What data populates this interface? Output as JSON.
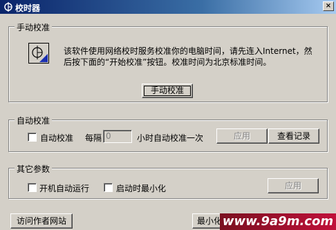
{
  "window": {
    "title": "校时器",
    "close_glyph": "×"
  },
  "manual_group": {
    "legend": "手动校准",
    "description": "该软件使用网络校时服务校准你的电脑时间，请先连入Internet，然后按下面的“开始校准”按钮。校准时间为北京标准时间。",
    "button_label": "手动校准"
  },
  "auto_group": {
    "legend": "自动校准",
    "checkbox_label": "自动校准",
    "every_label": "每隔",
    "interval_value": "0",
    "suffix_label": "小时自动校准一次",
    "apply_label": "应用",
    "view_log_label": "查看记录"
  },
  "other_group": {
    "legend": "其它参数",
    "startup_label": "开机自动运行",
    "minimize_label": "启动时最小化",
    "apply_label": "应用"
  },
  "footer": {
    "visit_label": "访问作者网站",
    "minimize_label": "最小化到系"
  },
  "watermark": {
    "text": "www.9a9m.com"
  },
  "colors": {
    "titlebar_start": "#0a246a",
    "titlebar_end": "#a6caf0",
    "face": "#d4d0c8"
  }
}
